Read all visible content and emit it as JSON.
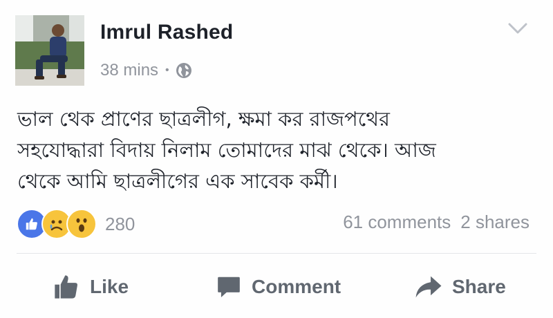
{
  "post": {
    "author": "Imrul Rashed",
    "time": "38 mins",
    "separator": "•",
    "privacy_icon": "globe-icon",
    "menu_icon": "chevron-down-icon",
    "text_lines": [
      "ভাল থেক প্রাণের ছাত্রলীগ, ক্ষমা কর রাজপথের",
      "সহযোদ্ধারা বিদায় নিলাম তোমাদের মাঝ থেকে। আজ",
      "থেকে আমি ছাত্রলীগের এক সাবেক কর্মী।"
    ],
    "reactions": {
      "icons": [
        "like-reaction-icon",
        "sad-reaction-icon",
        "wow-reaction-icon"
      ],
      "count": "280"
    },
    "comments": "61 comments",
    "shares": "2 shares"
  },
  "actions": {
    "like_label": "Like",
    "comment_label": "Comment",
    "share_label": "Share"
  },
  "colors": {
    "text": "#1d2129",
    "muted": "#90949c",
    "action": "#606770",
    "like_blue": "#4267b2",
    "reaction_yellow": "#f7c43c"
  }
}
